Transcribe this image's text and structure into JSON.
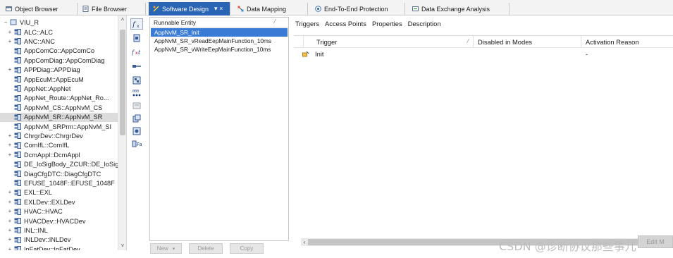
{
  "tabs": [
    {
      "label": "Object Browser",
      "icon": "object-browser-icon",
      "active": false
    },
    {
      "label": "File Browser",
      "icon": "file-browser-icon",
      "active": false
    },
    {
      "label": "Software Design",
      "icon": "software-design-icon",
      "active": true,
      "controls": "▾ ×"
    },
    {
      "label": "Data Mapping",
      "icon": "data-mapping-icon",
      "active": false
    },
    {
      "label": "End-To-End Protection",
      "icon": "e2e-protection-icon",
      "active": false
    },
    {
      "label": "Data Exchange Analysis",
      "icon": "data-exchange-icon",
      "active": false
    }
  ],
  "tree": {
    "root": "VIU_R",
    "items": [
      {
        "label": "ALC::ALC",
        "expandable": true,
        "selected": false
      },
      {
        "label": "ANC::ANC",
        "expandable": true,
        "selected": false
      },
      {
        "label": "AppComCo::AppComCo",
        "expandable": false,
        "selected": false
      },
      {
        "label": "AppComDiag::AppComDiag",
        "expandable": false,
        "selected": false
      },
      {
        "label": "APPDiag::APPDiag",
        "expandable": true,
        "selected": false
      },
      {
        "label": "AppEcuM::AppEcuM",
        "expandable": false,
        "selected": false
      },
      {
        "label": "AppNet::AppNet",
        "expandable": false,
        "selected": false
      },
      {
        "label": "AppNet_Route::AppNet_Ro...",
        "expandable": false,
        "selected": false
      },
      {
        "label": "AppNvM_CS::AppNvM_CS",
        "expandable": false,
        "selected": false
      },
      {
        "label": "AppNvM_SR::AppNvM_SR",
        "expandable": false,
        "selected": true
      },
      {
        "label": "AppNvM_SRPrm::AppNvM_SI",
        "expandable": false,
        "selected": false
      },
      {
        "label": "ChrgrDev::ChrgrDev",
        "expandable": true,
        "selected": false
      },
      {
        "label": "ComIfL::ComIfL",
        "expandable": true,
        "selected": false
      },
      {
        "label": "DcmAppl::DcmAppl",
        "expandable": true,
        "selected": false
      },
      {
        "label": "DE_IoSigBody_ZCUR::DE_IoSig",
        "expandable": false,
        "selected": false
      },
      {
        "label": "DiagCfgDTC::DiagCfgDTC",
        "expandable": false,
        "selected": false
      },
      {
        "label": "EFUSE_1048F::EFUSE_1048F",
        "expandable": false,
        "selected": false
      },
      {
        "label": "EXL::EXL",
        "expandable": true,
        "selected": false
      },
      {
        "label": "EXLDev::EXLDev",
        "expandable": true,
        "selected": false
      },
      {
        "label": "HVAC::HVAC",
        "expandable": true,
        "selected": false
      },
      {
        "label": "HVACDev::HVACDev",
        "expandable": true,
        "selected": false
      },
      {
        "label": "INL::INL",
        "expandable": true,
        "selected": false
      },
      {
        "label": "INLDev::INLDev",
        "expandable": true,
        "selected": false
      },
      {
        "label": "InFatDev::InFatDev",
        "expandable": true,
        "selected": false
      }
    ]
  },
  "toolbar": {
    "buttons": [
      "runnable-fx-icon",
      "port-icon",
      "interrunnable-icon",
      "connector-icon",
      "component-icon",
      "data-element-icon",
      "mode-icon",
      "pim-icon",
      "calibration-icon",
      "mapping-icon"
    ]
  },
  "runnables": {
    "header": "Runnable Entity",
    "items": [
      {
        "label": "AppNvM_SR_Init",
        "selected": true
      },
      {
        "label": "AppNvM_SR_vReadEepMainFunction_10ms",
        "selected": false
      },
      {
        "label": "AppNvM_SR_vWriteEepMainFunction_10ms",
        "selected": false
      }
    ],
    "buttons": {
      "new": "New",
      "new_caret": "▾",
      "delete": "Delete",
      "copy": "Copy"
    }
  },
  "detail": {
    "tabs": [
      "Triggers",
      "Access Points",
      "Properties",
      "Description"
    ],
    "active_tab": "Triggers",
    "columns": [
      "Trigger",
      "Disabled in Modes",
      "Activation Reason"
    ],
    "rows": [
      {
        "trigger": "Init",
        "disabled_in_modes": "",
        "activation_reason": "-"
      }
    ],
    "edit_button": "Edit M"
  },
  "watermark": "CSDN @诊断协议那些事儿",
  "colors": {
    "active_tab": "#2a64b5",
    "selected_runnable": "#3a7bd5",
    "selected_tree_row": "#dcdcdc"
  }
}
